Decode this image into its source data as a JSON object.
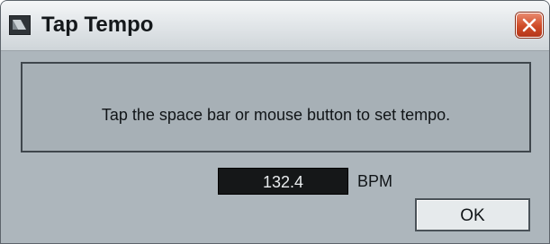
{
  "window": {
    "title": "Tap Tempo",
    "close_icon": "close-x-icon",
    "app_icon": "tempo-app-icon"
  },
  "message": {
    "text": "Tap the space bar or mouse button to set tempo."
  },
  "tempo": {
    "value": "132.4",
    "unit": "BPM"
  },
  "buttons": {
    "ok_label": "OK"
  },
  "colors": {
    "dialog_background": "#adb6bc",
    "display_background": "#151718",
    "display_text": "#e9ecee",
    "close_button": "#cf4b27"
  }
}
